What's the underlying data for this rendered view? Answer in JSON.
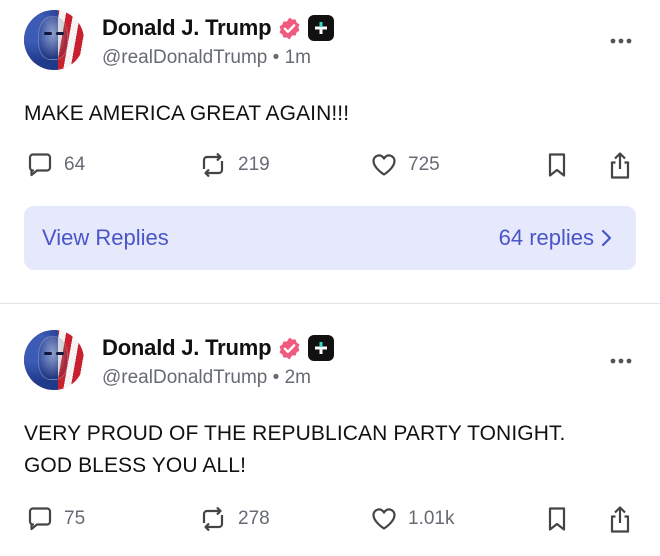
{
  "posts": [
    {
      "author": "Donald J. Trump",
      "handle_time": "@realDonaldTrump • 1m",
      "text_lines": [
        "MAKE AMERICA GREAT AGAIN!!!"
      ],
      "stats": {
        "replies": "64",
        "reposts": "219",
        "likes": "725"
      },
      "view_replies_label": "View Replies",
      "replies_count_label": "64 replies"
    },
    {
      "author": "Donald J. Trump",
      "handle_time": "@realDonaldTrump • 2m",
      "text_lines": [
        "VERY PROUD OF THE REPUBLICAN PARTY TONIGHT.",
        "GOD BLESS YOU ALL!"
      ],
      "stats": {
        "replies": "75",
        "reposts": "278",
        "likes": "1.01k"
      }
    }
  ],
  "colors": {
    "verified": "#f05a7e",
    "accent": "#4a55c8",
    "replies_bg": "#e6e8fc",
    "muted": "#666b73"
  },
  "icons": [
    "verified-badge-icon",
    "plus-badge-icon",
    "more-icon",
    "reply-icon",
    "repost-icon",
    "like-icon",
    "bookmark-icon",
    "share-icon",
    "chevron-right-icon"
  ]
}
